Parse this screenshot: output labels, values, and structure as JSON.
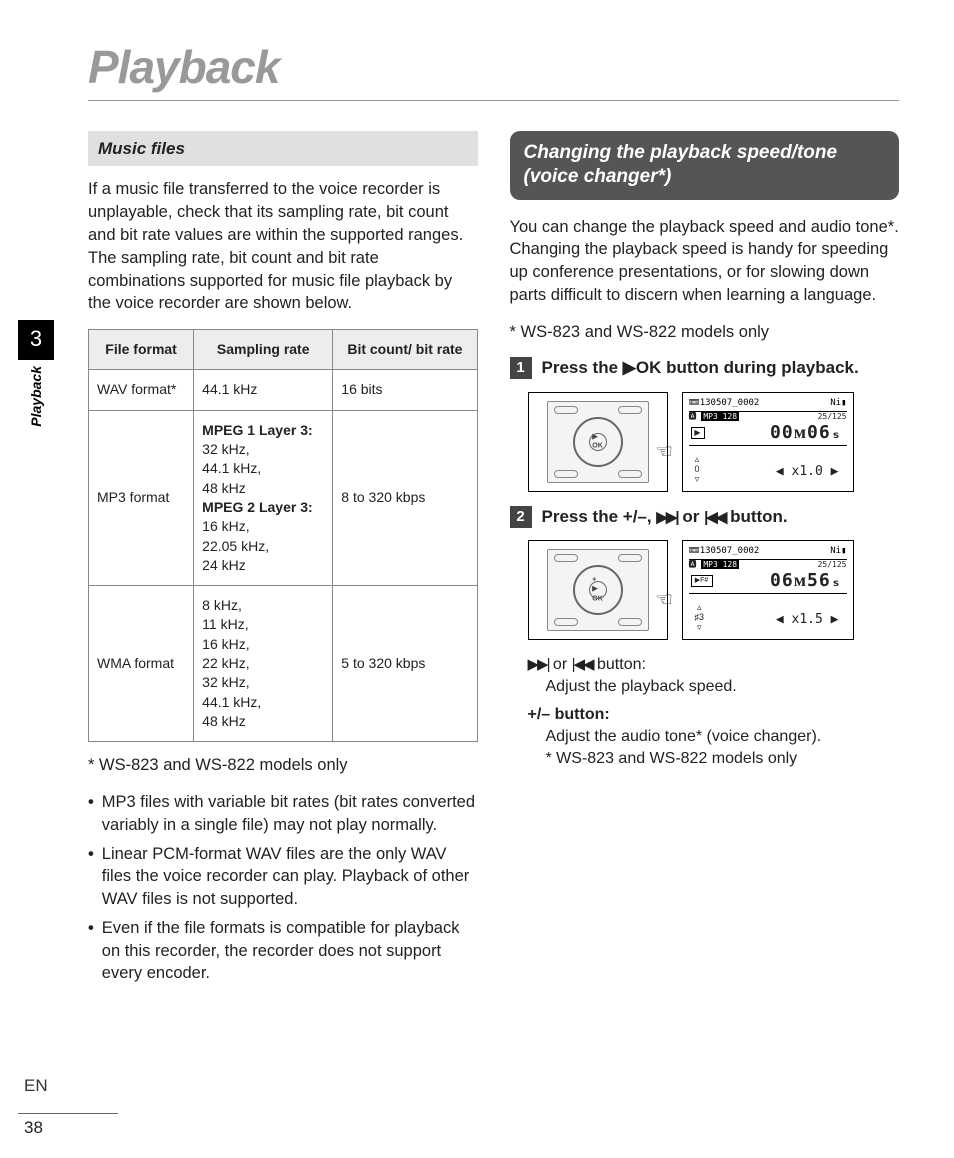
{
  "page": {
    "title": "Playback",
    "chapter_number": "3",
    "chapter_label": "Playback",
    "lang": "EN",
    "number": "38"
  },
  "left": {
    "subheader": "Music files",
    "intro": "If a music file transferred to the voice recorder is unplayable, check that its sampling rate, bit count and bit rate values are within the supported ranges. The sampling rate, bit count and bit rate combinations supported for music file playback by the voice recorder are shown below.",
    "table": {
      "headers": [
        "File format",
        "Sampling rate",
        "Bit count/ bit rate"
      ],
      "rows": [
        {
          "format": "WAV format*",
          "rate": "44.1 kHz",
          "bits": "16 bits"
        },
        {
          "format": "MP3 format",
          "rate_l1_title": "MPEG 1 Layer 3:",
          "rate_l1": "32 kHz,\n44.1 kHz,\n48 kHz",
          "rate_l2_title": "MPEG 2 Layer 3:",
          "rate_l2": "16 kHz,\n22.05 kHz,\n24 kHz",
          "bits": "8 to 320 kbps"
        },
        {
          "format": "WMA format",
          "rate": "8 kHz,\n 11 kHz,\n16 kHz,\n22 kHz,\n32 kHz,\n44.1 kHz,\n48 kHz",
          "bits": "5 to 320 kbps"
        }
      ]
    },
    "note_star": "* WS-823 and WS-822 models only",
    "bullets": [
      "MP3 files with variable bit rates (bit rates converted variably in a single file) may not play normally.",
      "Linear PCM-format WAV files are the only WAV files the voice recorder can play. Playback of other WAV files is not supported.",
      "Even if the file formats is compatible for playback on this recorder, the recorder does not support every encoder."
    ]
  },
  "right": {
    "callout": "Changing the playback speed/tone (voice changer*)",
    "intro": "You can change the playback speed and audio tone*. Changing the playback speed is handy for speeding up conference presentations, or for slowing down parts difficult to discern when learning a language.",
    "note_star": "* WS-823 and WS-822 models only",
    "step1_pre": "Press the ",
    "step1_ok": "OK",
    "step1_post": " button during playback.",
    "screen1": {
      "file": "130507_0002",
      "batt": "Ni",
      "fmt": "MP3 128",
      "count": "25/125",
      "time": "00ᴍ06ₛ",
      "play": "▶",
      "rate": "◀ x1.0 ▶",
      "mid": "0"
    },
    "step2_pre": "Press the ",
    "step2_mid1": "+/–, ",
    "step2_mid2": " or ",
    "step2_post": " button.",
    "screen2": {
      "file": "130507_0002",
      "batt": "Ni",
      "fmt": "MP3 128",
      "count": "25/125",
      "time": "06ᴍ56ₛ",
      "play": "▶F#",
      "rate": "◀ x1.5 ▶",
      "mid": "♯3"
    },
    "desc": {
      "ff_or": " or ",
      "ff_post": " button:",
      "ff_body": "Adjust the playback speed.",
      "pm_label": "+/– button:",
      "pm_body": "Adjust the audio tone* (voice changer).",
      "pm_note": "* WS-823 and WS-822 models only"
    }
  }
}
